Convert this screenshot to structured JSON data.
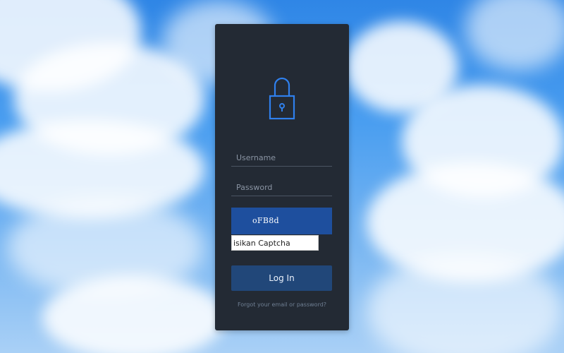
{
  "background": {
    "description_icon": "sky-clouds"
  },
  "login": {
    "lock_icon": "lock-icon",
    "username_placeholder": "Username",
    "password_placeholder": "Password",
    "captcha_code": "oFB8d",
    "captcha_placeholder": "isikan Captcha",
    "login_button": "Log In",
    "forgot_link": "Forgot your email or password?"
  },
  "colors": {
    "panel": "#232a34",
    "accent": "#2f80ed",
    "captcha_bg": "#1e4f9e",
    "button_bg": "#214779"
  }
}
